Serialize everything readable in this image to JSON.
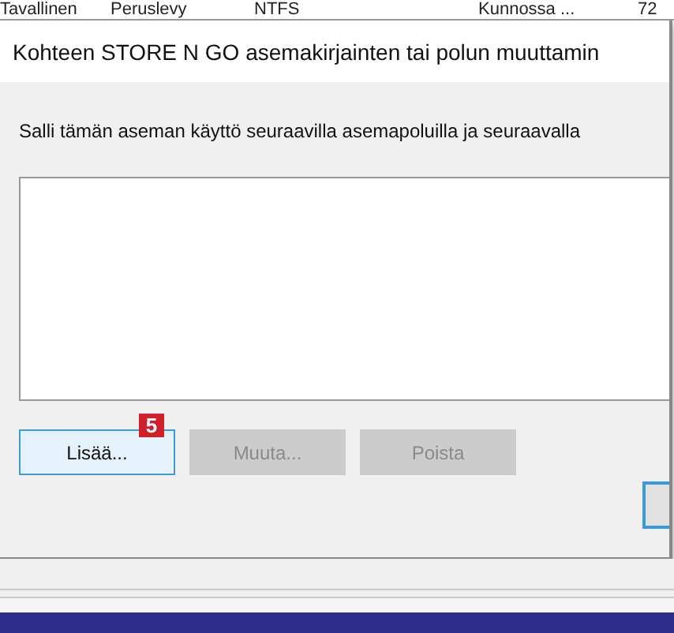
{
  "background_table": {
    "header": [
      "Tavallinen",
      "Peruslevy",
      "NTFS",
      "Kunnossa ...",
      "72"
    ]
  },
  "dialog": {
    "title": "Kohteen STORE N GO asemakirjainten tai polun muuttamin",
    "instruction": "Salli tämän aseman käyttö seuraavilla asemapoluilla ja seuraavalla",
    "buttons": [
      {
        "label": "Lisää...",
        "disabled": false,
        "focused": true,
        "badge": "5"
      },
      {
        "label": "Muuta...",
        "disabled": true,
        "focused": false
      },
      {
        "label": "Poista",
        "disabled": true,
        "focused": false
      }
    ],
    "default_button": {
      "focused": true
    }
  }
}
